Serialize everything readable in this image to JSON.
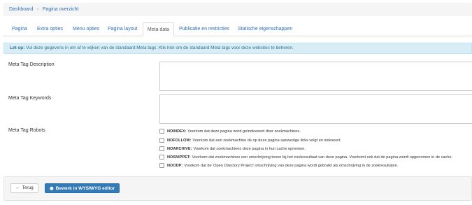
{
  "breadcrumb": {
    "home": "Dashboard",
    "current": "Pagina overzicht"
  },
  "tabs": [
    {
      "label": "Pagina",
      "active": false
    },
    {
      "label": "Extra opties",
      "active": false
    },
    {
      "label": "Menu opties",
      "active": false
    },
    {
      "label": "Pagina layout",
      "active": false
    },
    {
      "label": "Meta data",
      "active": true
    },
    {
      "label": "Publicatie en restricties",
      "active": false
    },
    {
      "label": "Statische eigenschappen",
      "active": false
    }
  ],
  "alert": {
    "prefix": "Let op:",
    "text": "Vul deze gegevens in om af te wijken van de standaard Meta tags. Klik hier om de standaard Meta tags voor deze websites te beheren."
  },
  "fields": {
    "description_label": "Meta Tag Description",
    "keywords_label": "Meta Tag Keywords",
    "robots_label": "Meta Tag Robots"
  },
  "robots": [
    {
      "key": "NOINDEX:",
      "text": "Voorkom dat deze pagina word geïndexeerd door zoekmachines."
    },
    {
      "key": "NOFOLLOW:",
      "text": "Voorkom dat een zoekmachine de op deze pagina aanwezige links volgt en indexeert."
    },
    {
      "key": "NOARCHIVE:",
      "text": "Voorkom dat zoekmachines deze pagina in hun cache opnemen."
    },
    {
      "key": "NOSNIPPET:",
      "text": "Voorkom dat zoekmachines een omschrijving tonen bij het zoekresultaat van deze pagina. Voorkomt ook dat de pagina wordt opgenomen in de cache."
    },
    {
      "key": "NOODP:",
      "text": "Voorkom dat de 'Open Directory Project' omschrijving van deze pagina wordt gebruikt als omschrijving in de zoekresultaten."
    }
  ],
  "buttons": {
    "back": "Terug",
    "edit": "Bewerk in WYSIWYG editor",
    "back_icon": "arrow-left-icon",
    "edit_icon": "eye-icon"
  },
  "colors": {
    "link": "#2a6ebb",
    "primary": "#337ab7",
    "alert_bg": "#d9edf7",
    "alert_text": "#31708f"
  }
}
